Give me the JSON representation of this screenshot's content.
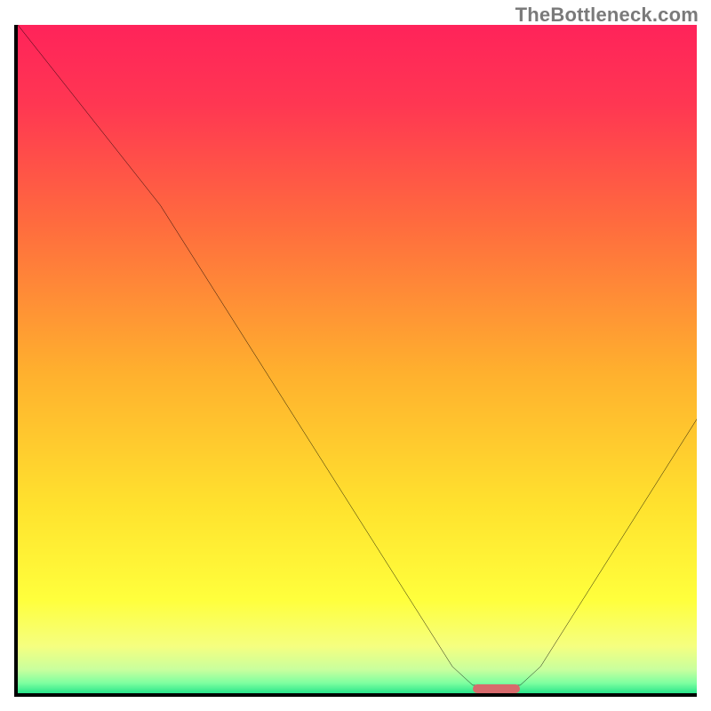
{
  "watermark": "TheBottleneck.com",
  "chart_data": {
    "type": "line",
    "title": "",
    "xlabel": "",
    "ylabel": "",
    "xlim": [
      0,
      100
    ],
    "ylim": [
      0,
      100
    ],
    "grid": false,
    "legend": false,
    "gradient_stops": [
      {
        "offset": 0.0,
        "color": "#ff235a"
      },
      {
        "offset": 0.12,
        "color": "#ff3752"
      },
      {
        "offset": 0.3,
        "color": "#ff6c3e"
      },
      {
        "offset": 0.52,
        "color": "#ffb02e"
      },
      {
        "offset": 0.72,
        "color": "#ffe22e"
      },
      {
        "offset": 0.86,
        "color": "#ffff3c"
      },
      {
        "offset": 0.93,
        "color": "#f5ff80"
      },
      {
        "offset": 0.965,
        "color": "#c8ff9e"
      },
      {
        "offset": 0.985,
        "color": "#7dffa0"
      },
      {
        "offset": 1.0,
        "color": "#29e58a"
      }
    ],
    "curve_points": [
      {
        "x": 0,
        "y": 100
      },
      {
        "x": 21,
        "y": 73
      },
      {
        "x": 64,
        "y": 4
      },
      {
        "x": 67,
        "y": 1.2
      },
      {
        "x": 74,
        "y": 1.2
      },
      {
        "x": 77,
        "y": 4
      },
      {
        "x": 100,
        "y": 41
      }
    ],
    "sweet_spot": {
      "x_start": 67,
      "x_end": 74,
      "y": 0.6
    },
    "description": "Bottleneck curve: vertical axis implies bottleneck percentage (high = red = bad, low = green = good), horizontal axis implies relative component performance; optimal point is near x≈70 where the curve touches the bottom green band."
  }
}
